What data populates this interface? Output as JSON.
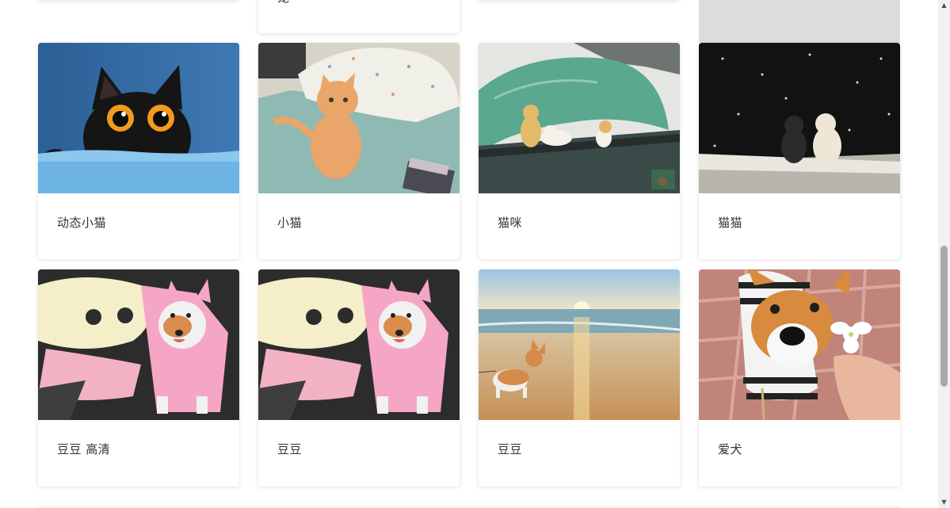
{
  "gallery": {
    "partial_top_card_title": "宠",
    "rows": [
      {
        "cards": [
          {
            "title": "动态小猫",
            "image": "black-kitten-orange-eyes"
          },
          {
            "title": "小猫",
            "image": "orange-cat-on-bed"
          },
          {
            "title": "猫咪",
            "image": "illustrated-cats-under-leaf"
          },
          {
            "title": "猫猫",
            "image": "two-cats-in-snow"
          }
        ]
      },
      {
        "cards": [
          {
            "title": "豆豆 高清",
            "image": "corgi-hello-kitty-raincoat"
          },
          {
            "title": "豆豆",
            "image": "corgi-hello-kitty-raincoat"
          },
          {
            "title": "豆豆",
            "image": "corgi-on-beach-sunset"
          },
          {
            "title": "爱犬",
            "image": "corgi-with-flower"
          }
        ]
      }
    ]
  },
  "scrollbar": {
    "up_icon": "triangle-up-icon",
    "down_icon": "triangle-down-icon"
  }
}
